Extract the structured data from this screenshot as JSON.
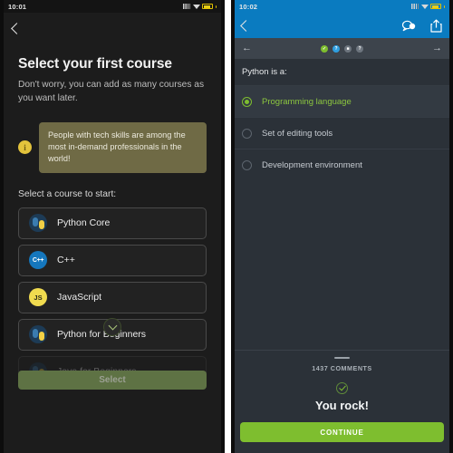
{
  "left_phone": {
    "status_bar": {
      "time": "10:01",
      "signal_icon": "signal-bars-icon",
      "wifi_icon": "wifi-icon",
      "battery_icon": "battery-icon"
    },
    "nav": {
      "back_icon": "chevron-left-icon"
    },
    "title": "Select your first course",
    "subtitle": "Don't worry, you can add as many courses as you want later.",
    "banner": {
      "icon": "info-icon",
      "icon_glyph": "i",
      "text": "People with tech skills are among the most in-demand professionals in the world!",
      "bg_color": "#6f6a45",
      "icon_color": "#e3c33c"
    },
    "section_label": "Select a course to start:",
    "courses": [
      {
        "name": "Python Core",
        "icon": "python-logo-icon"
      },
      {
        "name": "C++",
        "icon": "cpp-logo-icon",
        "icon_text": "C++"
      },
      {
        "name": "JavaScript",
        "icon": "javascript-logo-icon",
        "icon_text": "JS"
      },
      {
        "name": "Python for Beginners",
        "icon": "python-logo-icon"
      },
      {
        "name": "Java for Beginners",
        "icon": "java-logo-icon"
      }
    ],
    "scroll_indicator_icon": "chevron-down-icon",
    "select_button": {
      "label": "Select",
      "enabled": false,
      "bg_color": "#5e7244",
      "text_color": "#9ca093"
    }
  },
  "right_phone": {
    "status_bar": {
      "time": "10:02",
      "signal_icon": "signal-bars-icon",
      "wifi_icon": "wifi-icon",
      "battery_icon": "battery-icon"
    },
    "nav": {
      "back_icon": "chevron-left-icon",
      "comment_icon": "comment-bubble-icon",
      "share_icon": "share-icon",
      "bg_color": "#0a7bc0"
    },
    "steps": {
      "prev_icon": "arrow-left-icon",
      "prev_glyph": "←",
      "next_icon": "arrow-right-icon",
      "next_glyph": "→",
      "dots": [
        {
          "state": "done",
          "glyph": "✓",
          "color": "#7ebe2f"
        },
        {
          "state": "current",
          "glyph": "?",
          "color": "#2f9fe0"
        },
        {
          "state": "todo",
          "glyph": "■",
          "color": "#6d757e"
        },
        {
          "state": "todo",
          "glyph": "?",
          "color": "#6d757e"
        }
      ]
    },
    "question": "Python is a:",
    "options": [
      {
        "label": "Programming language",
        "selected": true
      },
      {
        "label": "Set of editing tools",
        "selected": false
      },
      {
        "label": "Development environment",
        "selected": false
      }
    ],
    "sheet": {
      "grabber": "drag-handle",
      "comments_count": "1437 COMMENTS",
      "result_icon": "check-circle-icon",
      "result_text": "You rock!",
      "continue_button": {
        "label": "CONTINUE",
        "bg_color": "#7ebe2f"
      }
    }
  }
}
